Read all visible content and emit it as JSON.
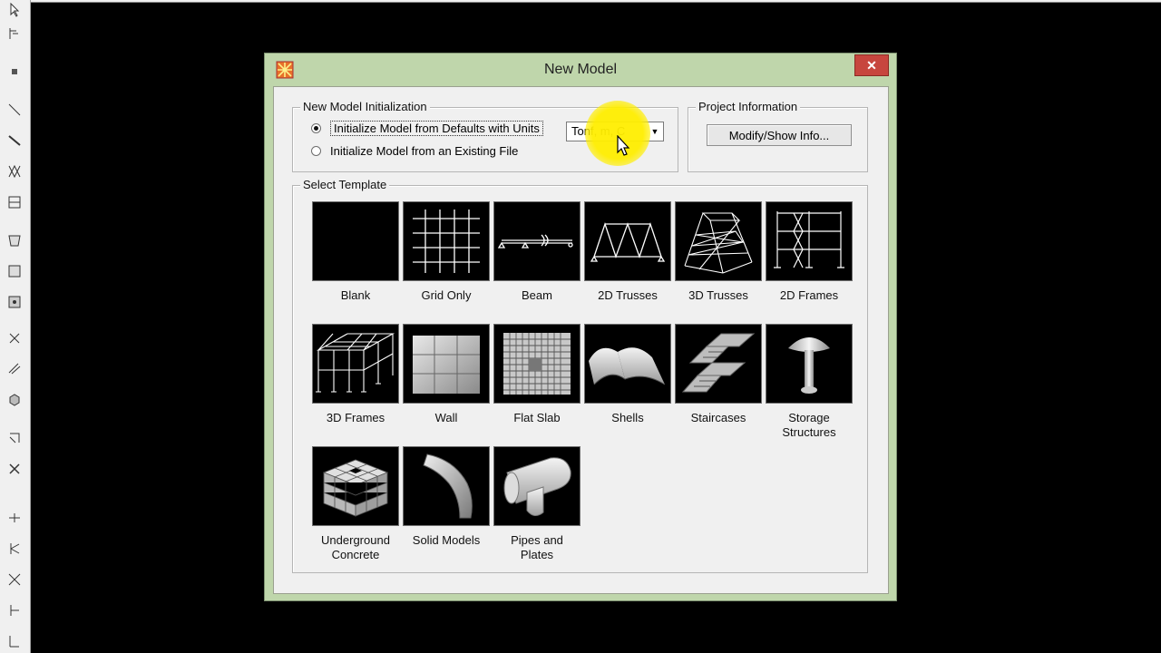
{
  "dialog": {
    "title": "New Model",
    "close_label": "✕"
  },
  "init_group": {
    "legend": "New Model Initialization",
    "option_defaults": "Initialize Model from Defaults with Units",
    "option_existing": "Initialize Model  from an Existing File",
    "units_value": "Tonf, m, C"
  },
  "project_group": {
    "legend": "Project Information",
    "button_label": "Modify/Show Info..."
  },
  "template_group": {
    "legend": "Select Template",
    "templates": [
      {
        "label": "Blank",
        "icon": "blank-icon"
      },
      {
        "label": "Grid Only",
        "icon": "grid-icon"
      },
      {
        "label": "Beam",
        "icon": "beam-icon"
      },
      {
        "label": "2D Trusses",
        "icon": "2d-truss-icon"
      },
      {
        "label": "3D Trusses",
        "icon": "3d-truss-icon"
      },
      {
        "label": "2D Frames",
        "icon": "2d-frame-icon"
      },
      {
        "label": "3D Frames",
        "icon": "3d-frame-icon"
      },
      {
        "label": "Wall",
        "icon": "wall-icon"
      },
      {
        "label": "Flat Slab",
        "icon": "flat-slab-icon"
      },
      {
        "label": "Shells",
        "icon": "shell-icon"
      },
      {
        "label": "Staircases",
        "icon": "staircase-icon"
      },
      {
        "label": "Storage\nStructures",
        "icon": "storage-structure-icon"
      },
      {
        "label": "Underground\nConcrete",
        "icon": "underground-concrete-icon"
      },
      {
        "label": "Solid Models",
        "icon": "solid-model-icon"
      },
      {
        "label": "Pipes and\nPlates",
        "icon": "pipe-plate-icon"
      }
    ]
  }
}
